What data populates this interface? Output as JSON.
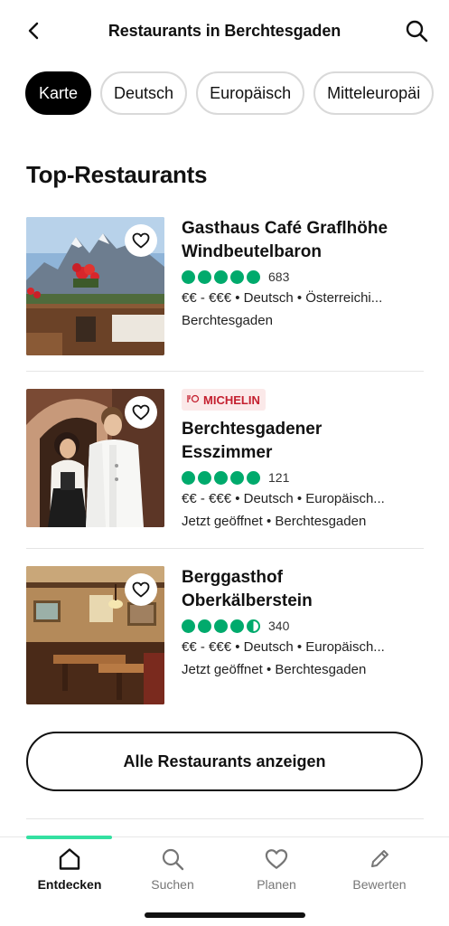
{
  "header": {
    "title": "Restaurants in Berchtesgaden",
    "back_icon": "chevron-left-icon",
    "search_icon": "search-icon"
  },
  "filters": [
    {
      "label": "Karte",
      "active": true
    },
    {
      "label": "Deutsch",
      "active": false
    },
    {
      "label": "Europäisch",
      "active": false
    },
    {
      "label": "Mitteleuropäi",
      "active": false
    }
  ],
  "section_title": "Top-Restaurants",
  "restaurants": [
    {
      "name_line1": "Gasthaus Café Graflhöhe",
      "name_line2": "Windbeutelbaron",
      "rating": 5,
      "reviews": "683",
      "meta": "€€ - €€€ • Deutsch • Österreichi...",
      "location": "Berchtesgaden"
    },
    {
      "badge": "MICHELIN",
      "name_line1": "Berchtesgadener",
      "name_line2": "Esszimmer",
      "rating": 5,
      "reviews": "121",
      "meta": "€€ - €€€ • Deutsch • Europäisch...",
      "location": "Jetzt geöffnet • Berchtesgaden"
    },
    {
      "name_line1": "Berggasthof",
      "name_line2": "Oberkälberstein",
      "rating": 4.5,
      "reviews": "340",
      "meta": "€€ - €€€ • Deutsch • Europäisch...",
      "location": "Jetzt geöffnet • Berchtesgaden"
    }
  ],
  "cta_label": "Alle Restaurants anzeigen",
  "nav": [
    {
      "label": "Entdecken",
      "icon": "home-icon",
      "active": true
    },
    {
      "label": "Suchen",
      "icon": "search-icon",
      "active": false
    },
    {
      "label": "Planen",
      "icon": "heart-icon",
      "active": false
    },
    {
      "label": "Bewerten",
      "icon": "pencil-icon",
      "active": false
    }
  ],
  "colors": {
    "rating_green": "#00aa6c",
    "active_tab_bar": "#34e0a1",
    "michelin_red": "#c4202f"
  }
}
